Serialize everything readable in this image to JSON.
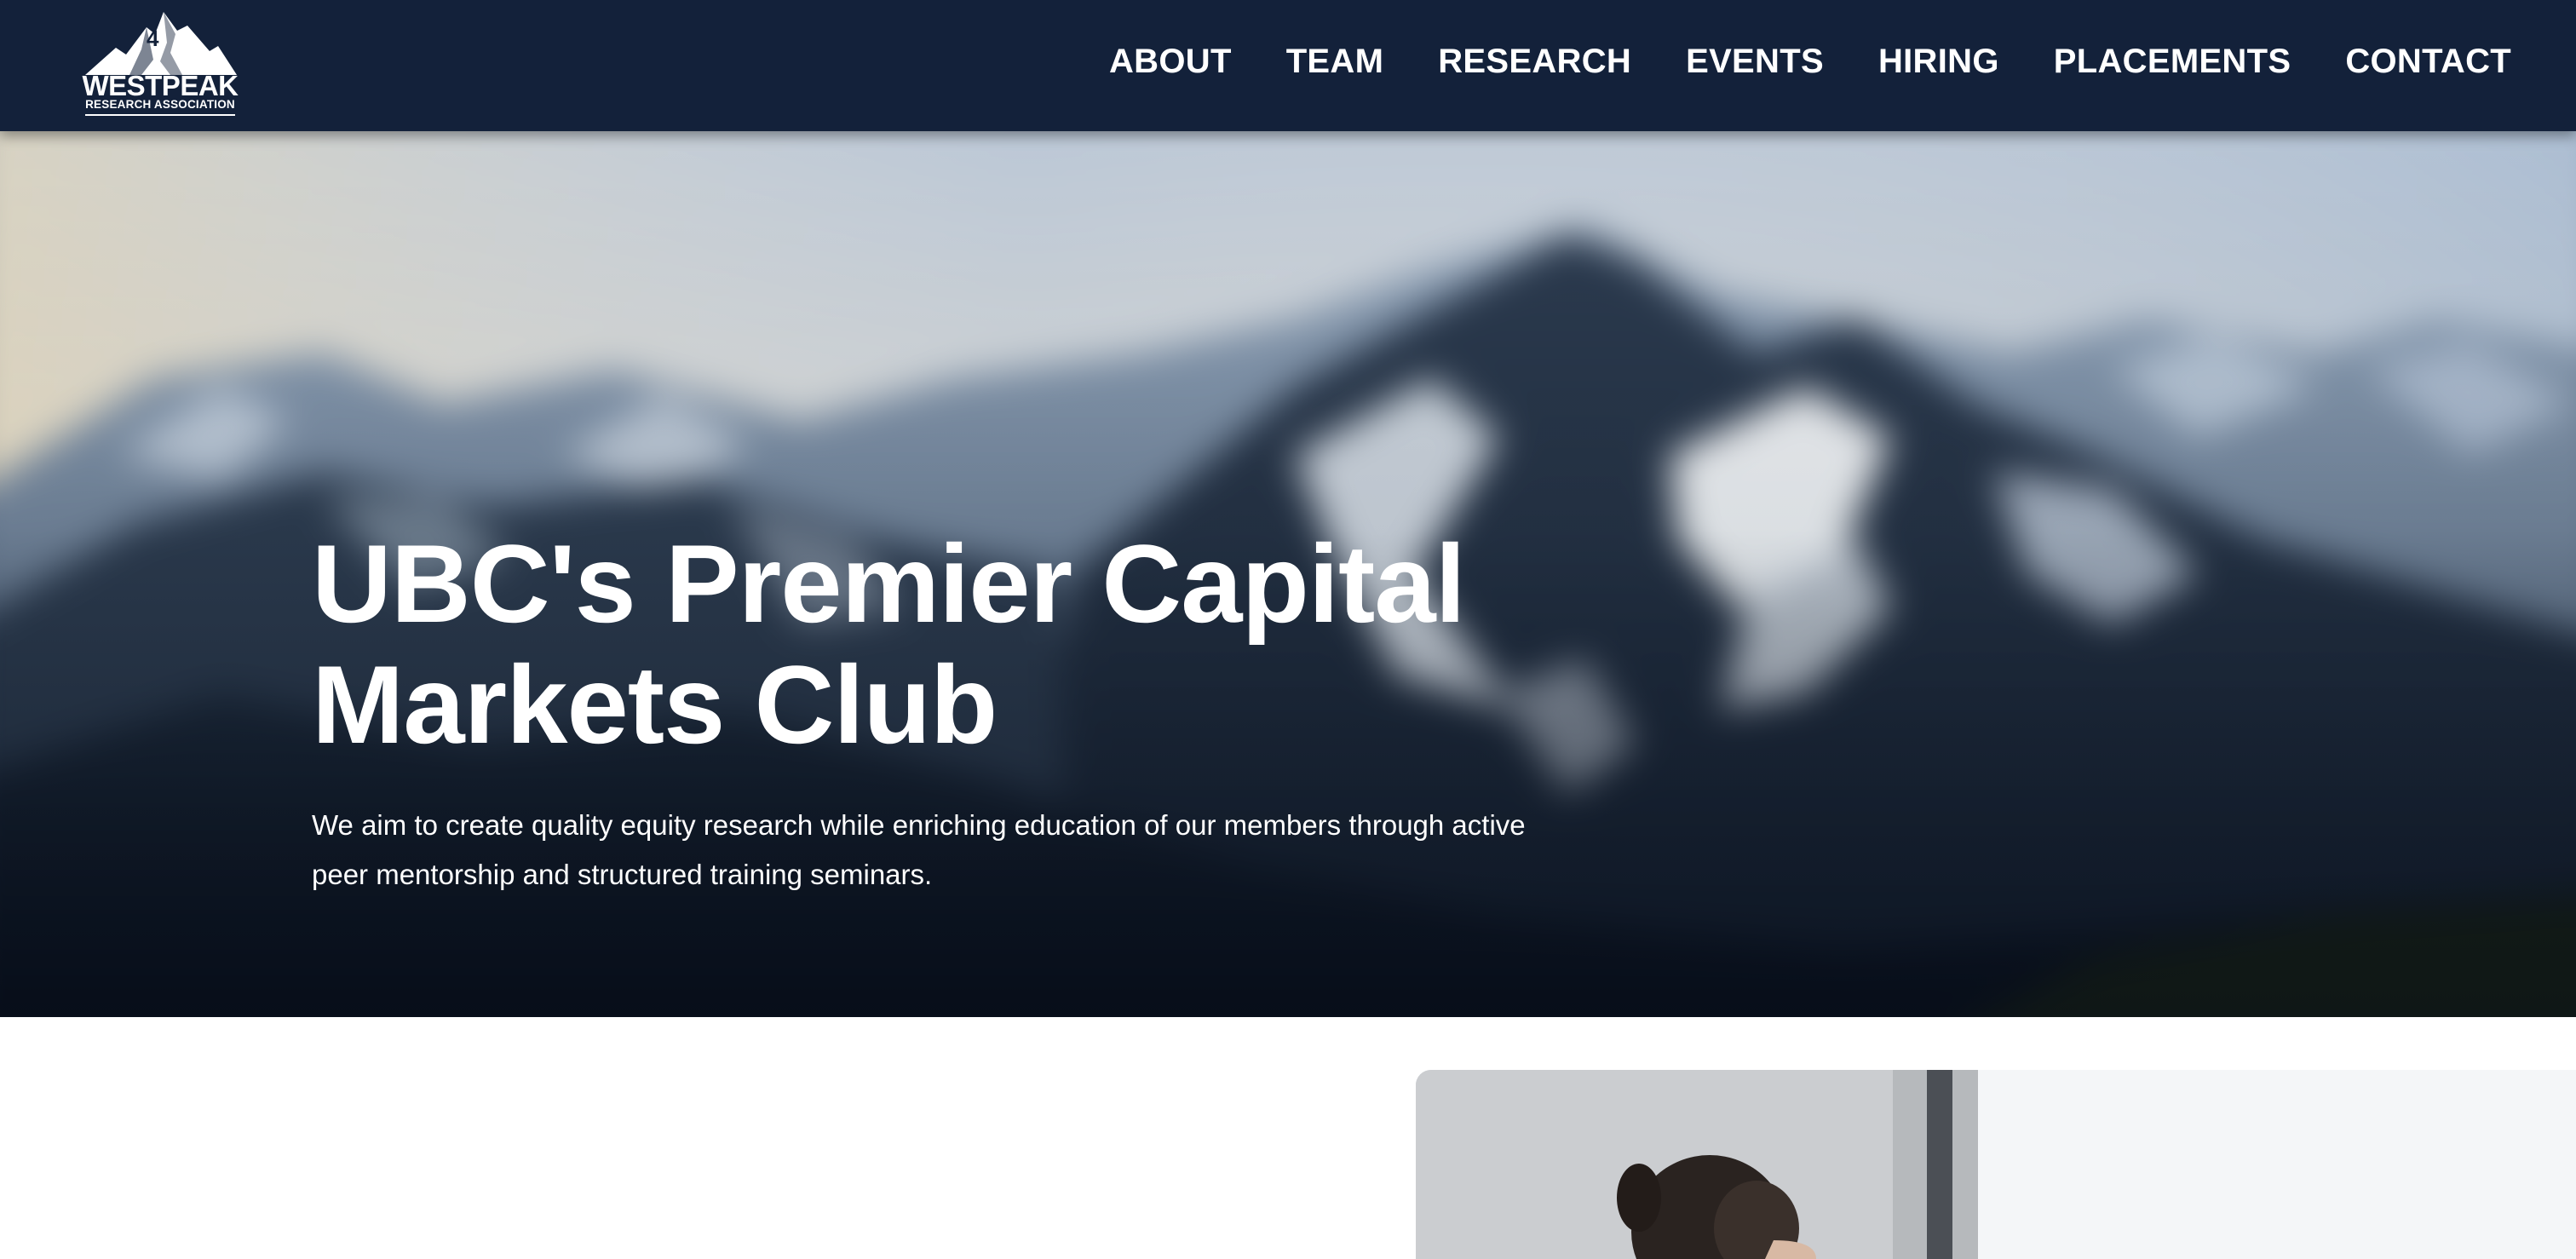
{
  "logo": {
    "title": "WESTPEAK",
    "subtitle": "RESEARCH ASSOCIATION"
  },
  "nav": {
    "items": [
      {
        "label": "ABOUT"
      },
      {
        "label": "TEAM"
      },
      {
        "label": "RESEARCH"
      },
      {
        "label": "EVENTS"
      },
      {
        "label": "HIRING"
      },
      {
        "label": "PLACEMENTS"
      },
      {
        "label": "CONTACT"
      }
    ]
  },
  "hero": {
    "title": "UBC's Premier Capital Markets Club",
    "description": "We aim to create quality equity research while enriching education of our members through active peer mentorship and structured training seminars."
  },
  "colors": {
    "navbar": "#13213a",
    "text": "#ffffff"
  }
}
